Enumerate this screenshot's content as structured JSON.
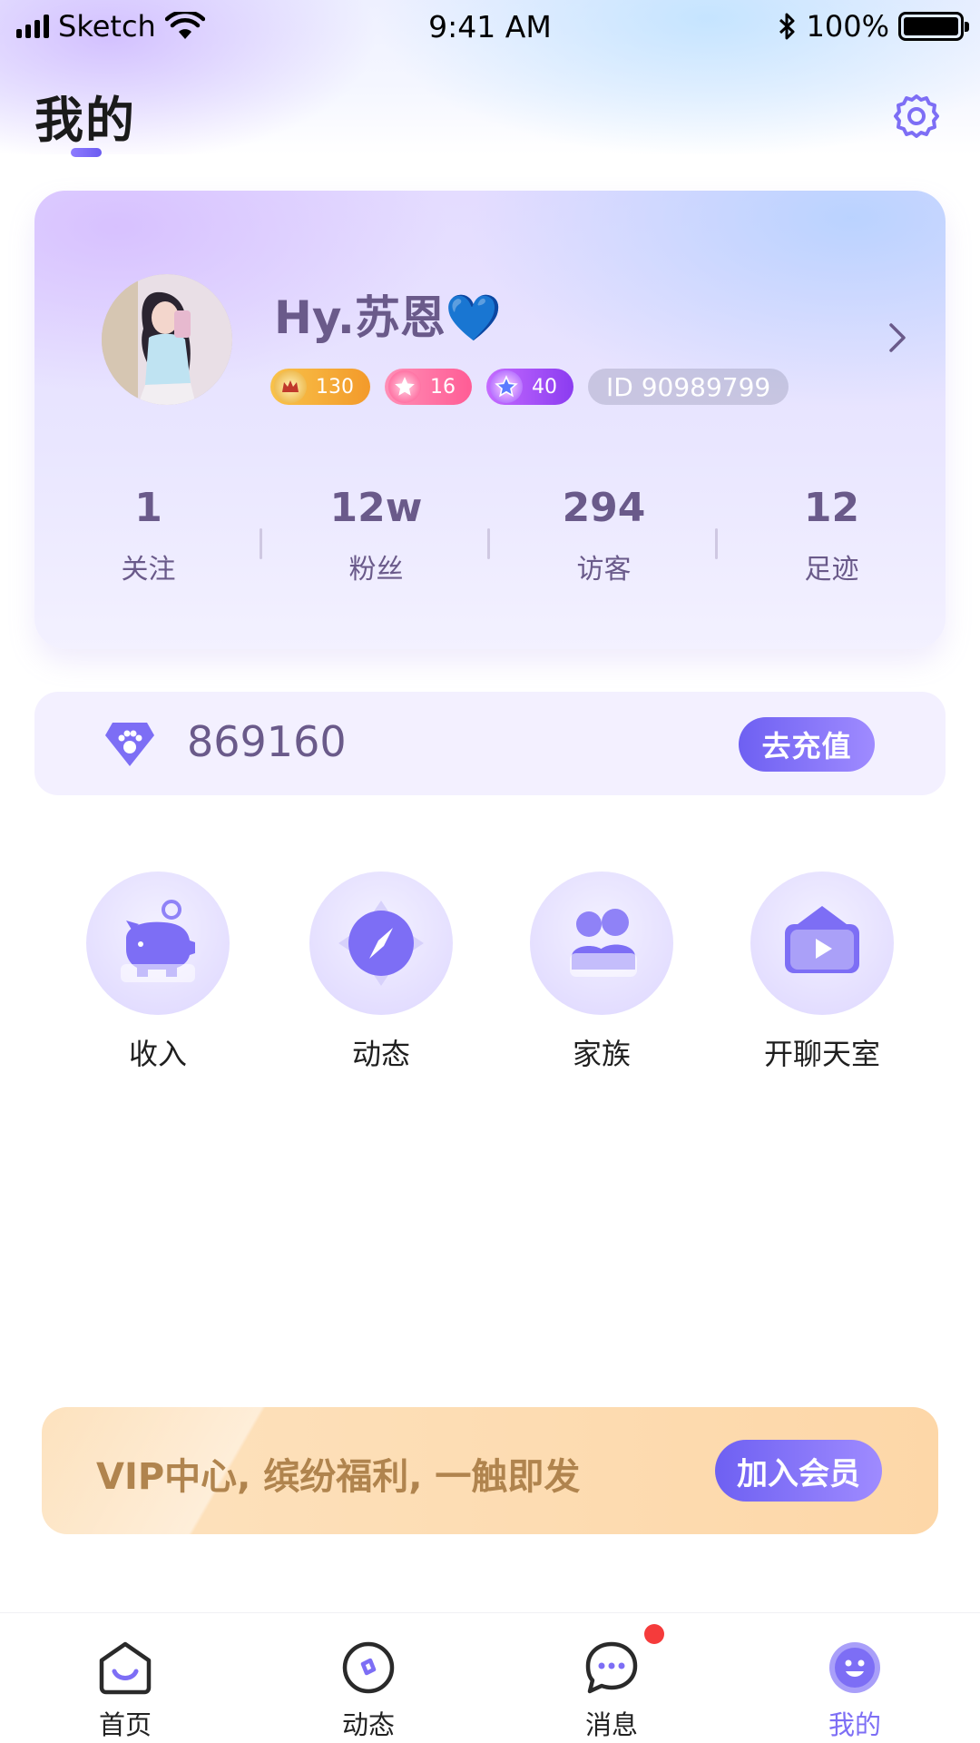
{
  "status_bar": {
    "carrier": "Sketch",
    "time": "9:41 AM",
    "battery": "100%"
  },
  "header": {
    "title": "我的"
  },
  "profile": {
    "name": "Hy.苏恩💙",
    "badges": [
      {
        "type": "wealth",
        "value": "130"
      },
      {
        "type": "charm",
        "value": "16"
      },
      {
        "type": "level",
        "value": "40"
      }
    ],
    "id_text": "ID 90989799",
    "stats": [
      {
        "value": "1",
        "label": "关注"
      },
      {
        "value": "12w",
        "label": "粉丝"
      },
      {
        "value": "294",
        "label": "访客"
      },
      {
        "value": "12",
        "label": "足迹"
      }
    ]
  },
  "balance": {
    "amount": "869160",
    "recharge_label": "去充值"
  },
  "features": [
    {
      "label": "收入",
      "icon": "piggy-bank-icon"
    },
    {
      "label": "动态",
      "icon": "compass-icon"
    },
    {
      "label": "家族",
      "icon": "family-icon"
    },
    {
      "label": "开聊天室",
      "icon": "video-room-icon"
    }
  ],
  "vip": {
    "text": "VIP中心, 缤纷福利, 一触即发",
    "button": "加入会员"
  },
  "tabs": [
    {
      "label": "首页",
      "icon": "home-icon",
      "active": false
    },
    {
      "label": "动态",
      "icon": "moments-icon",
      "active": false
    },
    {
      "label": "消息",
      "icon": "message-icon",
      "active": false,
      "has_badge": true
    },
    {
      "label": "我的",
      "icon": "profile-icon",
      "active": true
    }
  ],
  "colors": {
    "accent": "#7d6ef5",
    "text_muted": "#6a5a8a",
    "vip_text": "#b0844e",
    "notification": "#f53b3b"
  }
}
